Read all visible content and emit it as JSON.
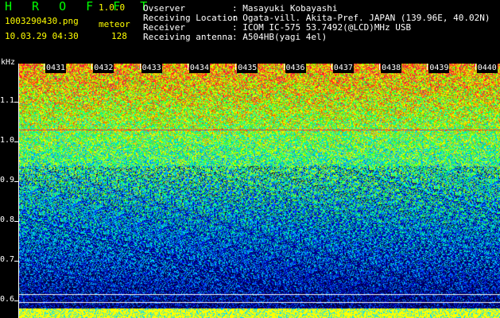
{
  "header": {
    "app_title": "H R O F F T",
    "version": "1.0.0",
    "file_name": "1003290430.png",
    "mode_label": "meteor",
    "date_time": "10.03.29 04:30",
    "count": "128"
  },
  "info": {
    "rows": [
      {
        "label": "Ovserver",
        "value": "Masayuki Kobayashi"
      },
      {
        "label": "Receiving Location",
        "value": "Ogata-vill. Akita-Pref. JAPAN (139.96E, 40.02N)"
      },
      {
        "label": "Receiver",
        "value": "ICOM IC-575 53.7492(@LCD)MHz USB"
      },
      {
        "label": "Receiving antenna",
        "value": "A504HB(yagi 4el)"
      }
    ]
  },
  "axis": {
    "unit": "kHz",
    "y_ticks": [
      "1.1",
      "1.0",
      "0.9",
      "0.8",
      "0.7",
      "0.6"
    ],
    "x_ticks": [
      "0431",
      "0432",
      "0433",
      "0434",
      "0435",
      "0436",
      "0437",
      "0438",
      "0439",
      "0440"
    ]
  },
  "colors": {
    "title": "#00ff00",
    "meta": "#ffff00",
    "background": "#000000"
  }
}
